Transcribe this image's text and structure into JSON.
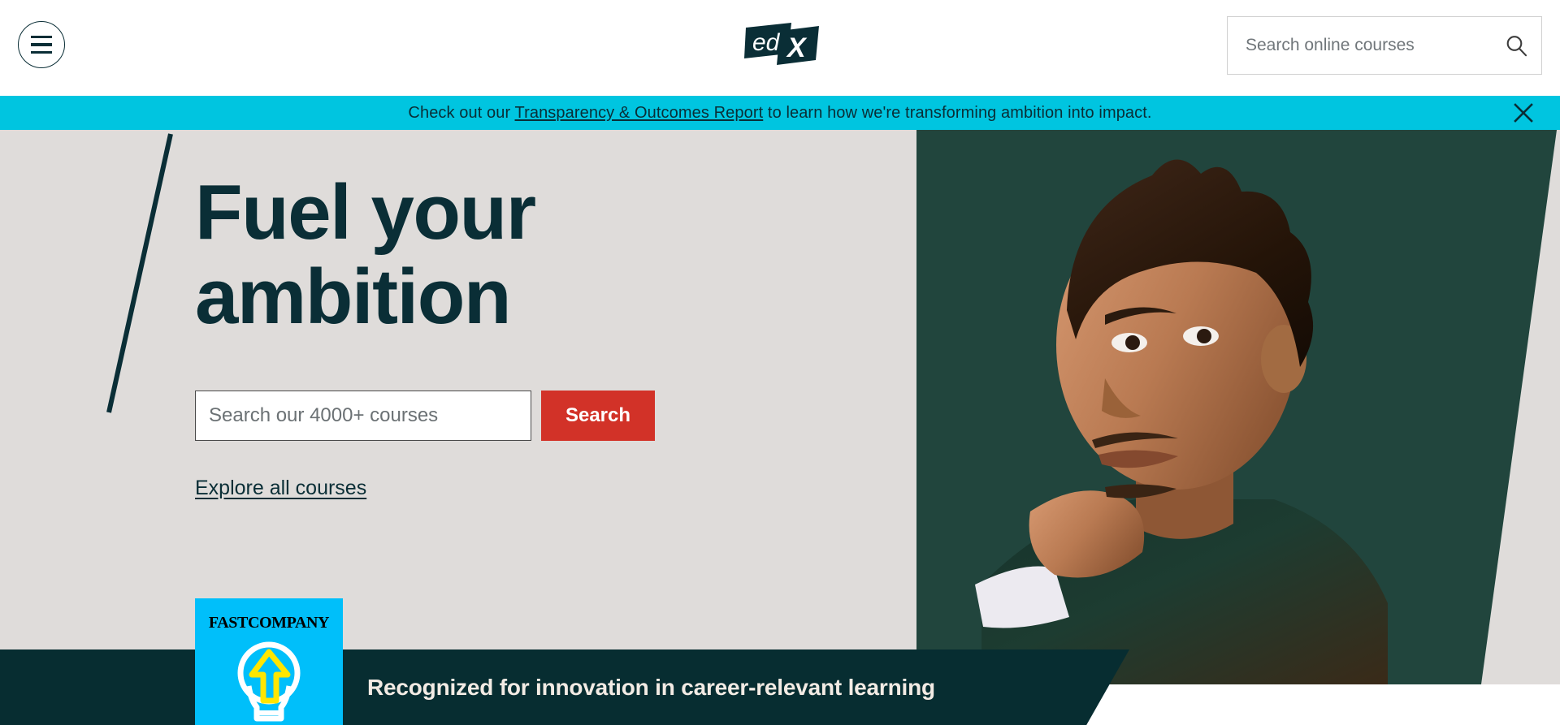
{
  "header": {
    "menu_button_name": "Main menu",
    "logo_text": "edX",
    "search": {
      "placeholder": "Search online courses",
      "value": "",
      "icon": "search-icon"
    }
  },
  "promo_banner": {
    "text_before": "Check out our ",
    "link_text": "Transparency & Outcomes Report",
    "text_after": " to learn how we're transforming ambition into impact.",
    "close_icon": "close-icon",
    "background_color": "#00c5e0"
  },
  "hero": {
    "title_line1": "Fuel your",
    "title_line2": "ambition",
    "search": {
      "placeholder": "Search our 4000+ courses",
      "value": "",
      "button_label": "Search",
      "button_color": "#d23228"
    },
    "explore_link": "Explore all courses",
    "background_color": "#dfdcda",
    "photo_background_color": "#21453d"
  },
  "award_banner": {
    "headline": "Recognized for innovation in career-relevant learning",
    "badge": {
      "brand": "FASTCOMPANY",
      "icon": "lightbulb-icon",
      "background_color": "#00bffa",
      "arrow_color": "#ffe600"
    },
    "background_color": "#072d31"
  }
}
